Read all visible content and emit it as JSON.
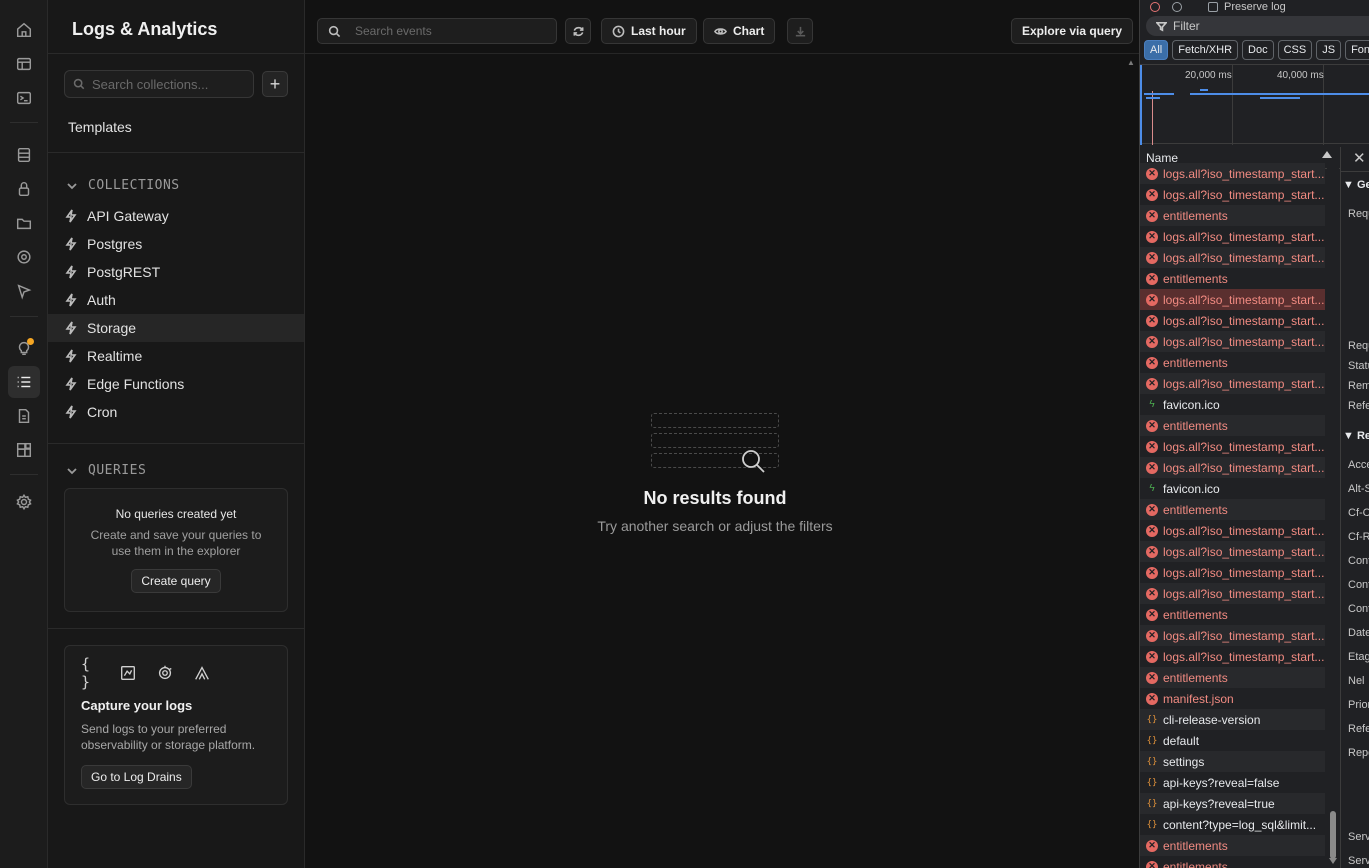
{
  "rail": {
    "icons": [
      "home-icon",
      "table-editor-icon",
      "sql-editor-icon",
      "database-icon",
      "auth-icon",
      "storage-icon",
      "realtime-icon",
      "edge-functions-icon",
      "advisors-icon",
      "logs-icon",
      "reports-icon",
      "integrations-icon",
      "settings-icon"
    ],
    "active": "logs-icon",
    "badge_color": "#f5a623"
  },
  "sidebar": {
    "title": "Logs & Analytics",
    "search_placeholder": "Search collections...",
    "add_label": "+",
    "templates_label": "Templates",
    "collections_heading": "COLLECTIONS",
    "collections": [
      "API Gateway",
      "Postgres",
      "PostgREST",
      "Auth",
      "Storage",
      "Realtime",
      "Edge Functions",
      "Cron"
    ],
    "active_collection": "Storage",
    "queries_heading": "QUERIES",
    "queries_card": {
      "title": "No queries created yet",
      "description": "Create and save your queries to use them in the explorer",
      "button": "Create query"
    },
    "capture_card": {
      "icon_glyph": "{ }",
      "title": "Capture your logs",
      "description": "Send logs to your preferred observability or storage platform.",
      "button": "Go to Log Drains"
    }
  },
  "toolbar": {
    "search_placeholder": "Search events",
    "time_range": "Last hour",
    "chart_label": "Chart",
    "explore_label": "Explore via query"
  },
  "empty_state": {
    "title": "No results found",
    "subtitle": "Try another search or adjust the filters"
  },
  "devtools": {
    "preserve_log": "Preserve log",
    "filter_placeholder": "Filter",
    "type_filters": [
      "All",
      "Fetch/XHR",
      "Doc",
      "CSS",
      "JS",
      "Font"
    ],
    "active_type": "All",
    "timeline_labels": [
      "20,000 ms",
      "40,000 ms"
    ],
    "name_header": "Name",
    "requests": [
      {
        "name": "logs.all?iso_timestamp_start...",
        "status": "error"
      },
      {
        "name": "logs.all?iso_timestamp_start...",
        "status": "error"
      },
      {
        "name": "entitlements",
        "status": "error"
      },
      {
        "name": "logs.all?iso_timestamp_start...",
        "status": "error"
      },
      {
        "name": "logs.all?iso_timestamp_start...",
        "status": "error"
      },
      {
        "name": "entitlements",
        "status": "error"
      },
      {
        "name": "logs.all?iso_timestamp_start...",
        "status": "error",
        "selected": true
      },
      {
        "name": "logs.all?iso_timestamp_start...",
        "status": "error"
      },
      {
        "name": "logs.all?iso_timestamp_start...",
        "status": "error"
      },
      {
        "name": "entitlements",
        "status": "error"
      },
      {
        "name": "logs.all?iso_timestamp_start...",
        "status": "error"
      },
      {
        "name": "favicon.ico",
        "status": "ok-bolt"
      },
      {
        "name": "entitlements",
        "status": "error"
      },
      {
        "name": "logs.all?iso_timestamp_start...",
        "status": "error"
      },
      {
        "name": "logs.all?iso_timestamp_start...",
        "status": "error"
      },
      {
        "name": "favicon.ico",
        "status": "ok-bolt"
      },
      {
        "name": "entitlements",
        "status": "error"
      },
      {
        "name": "logs.all?iso_timestamp_start...",
        "status": "error"
      },
      {
        "name": "logs.all?iso_timestamp_start...",
        "status": "error"
      },
      {
        "name": "logs.all?iso_timestamp_start...",
        "status": "error"
      },
      {
        "name": "logs.all?iso_timestamp_start...",
        "status": "error"
      },
      {
        "name": "entitlements",
        "status": "error"
      },
      {
        "name": "logs.all?iso_timestamp_start...",
        "status": "error"
      },
      {
        "name": "logs.all?iso_timestamp_start...",
        "status": "error"
      },
      {
        "name": "entitlements",
        "status": "error"
      },
      {
        "name": "manifest.json",
        "status": "error"
      },
      {
        "name": "cli-release-version",
        "status": "ok-json"
      },
      {
        "name": "default",
        "status": "ok-json"
      },
      {
        "name": "settings",
        "status": "ok-json"
      },
      {
        "name": "api-keys?reveal=false",
        "status": "ok-json"
      },
      {
        "name": "api-keys?reveal=true",
        "status": "ok-json"
      },
      {
        "name": "content?type=log_sql&limit...",
        "status": "ok-json"
      },
      {
        "name": "entitlements",
        "status": "error"
      },
      {
        "name": "entitlements",
        "status": "error"
      }
    ],
    "detail": {
      "close": "✕",
      "general_section": "▼ Ge",
      "general_labels": [
        "Requ"
      ],
      "general_labels_2": [
        "Requ",
        "Statu",
        "Rem",
        "Refe"
      ],
      "response_section": "▼ Re",
      "response_labels": [
        "Acce",
        "Alt-S",
        "Cf-C",
        "Cf-R",
        "Cont",
        "Cont",
        "Cont",
        "Date",
        "Etag",
        "Nel",
        "Prior",
        "Refe",
        "Repo"
      ],
      "footer_labels": [
        "Serv",
        "Serv"
      ]
    }
  }
}
